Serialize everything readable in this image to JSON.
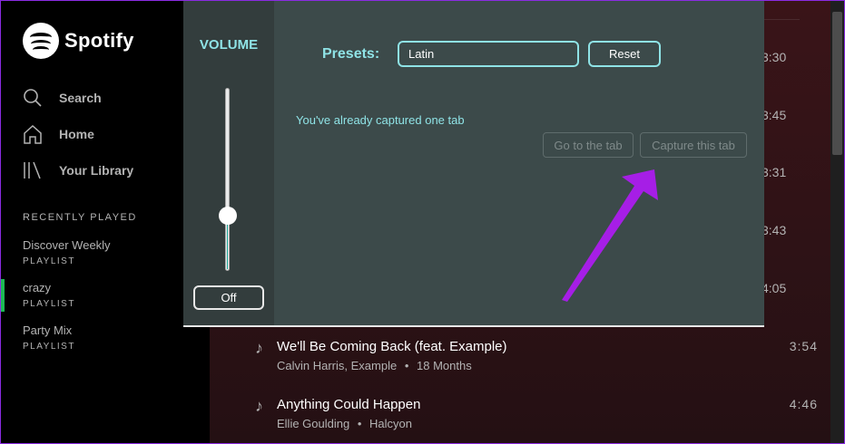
{
  "app": {
    "logo_text": "Spotify",
    "accent": "#1db954",
    "highlight_color": "#8fe3e6"
  },
  "sidebar": {
    "nav": [
      {
        "label": "Search",
        "icon": "search-icon"
      },
      {
        "label": "Home",
        "icon": "home-icon"
      },
      {
        "label": "Your Library",
        "icon": "library-icon"
      }
    ],
    "section_title": "RECENTLY PLAYED",
    "playlists": [
      {
        "name": "Discover Weekly",
        "type": "PLAYLIST"
      },
      {
        "name": "crazy",
        "type": "PLAYLIST"
      },
      {
        "name": "Party Mix",
        "type": "PLAYLIST"
      }
    ]
  },
  "tracklist": {
    "partial_durations": [
      "3:30",
      "3:45",
      "3:31",
      "3:43",
      "4:05"
    ],
    "tracks": [
      {
        "title": "We'll Be Coming Back (feat. Example)",
        "artist": "Calvin Harris, Example",
        "album": "18 Months",
        "duration": "3:54"
      },
      {
        "title": "Anything Could Happen",
        "artist": "Ellie Goulding",
        "album": "Halcyon",
        "duration": "4:46"
      }
    ],
    "separator": "•"
  },
  "popup": {
    "volume_label": "VOLUME",
    "volume_level": 0.3,
    "off_label": "Off",
    "presets_label": "Presets:",
    "preset_value": "Latin",
    "reset_label": "Reset",
    "status_text": "You've already captured one tab",
    "goto_label": "Go to the tab",
    "capture_label": "Capture this tab"
  }
}
